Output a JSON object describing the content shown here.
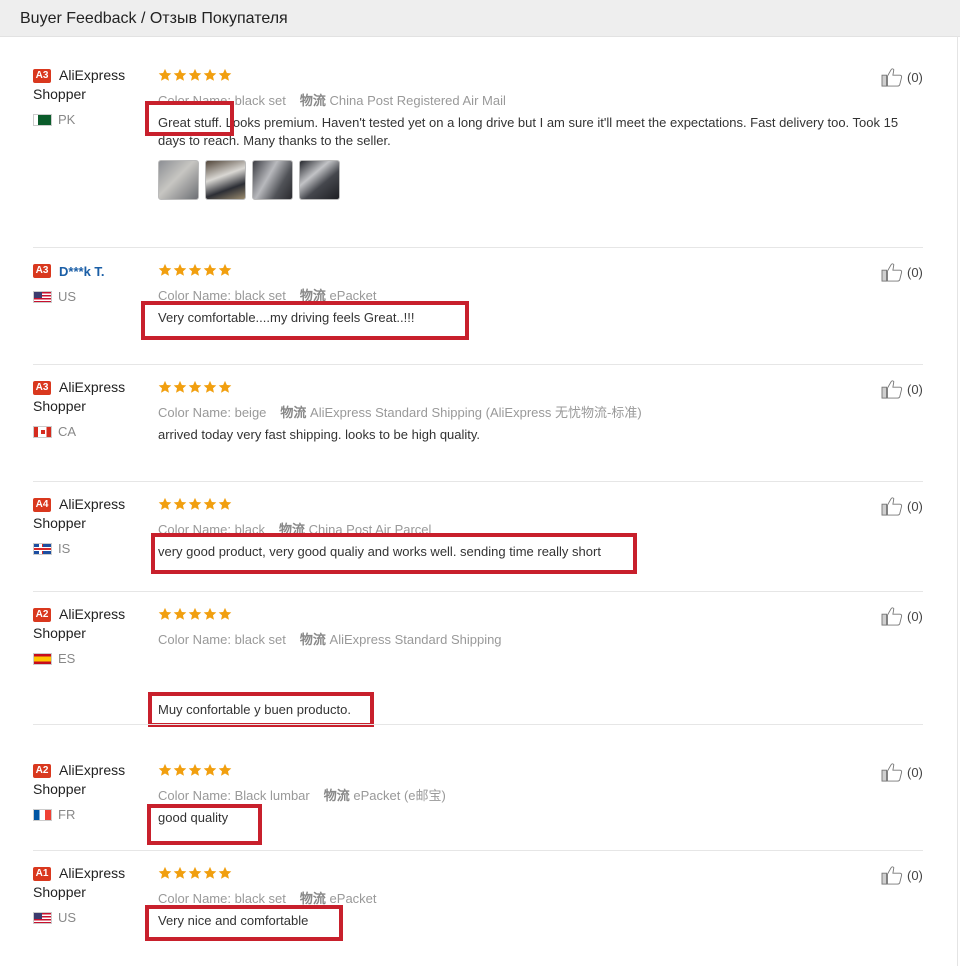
{
  "header": {
    "title": "Buyer Feedback / Отзыв Покупателя"
  },
  "colors": {
    "highlight": "#c8202c",
    "badge": "#d9381e",
    "star": "#f19f0f"
  },
  "reviews": [
    {
      "badge": "A3",
      "name": "AliExpress Shopper",
      "country": "PK",
      "flag": "pk",
      "stars": 5,
      "color_label": "Color Name:",
      "color_value": "black set",
      "shipping_label": "物流",
      "shipping_value": "China Post Registered Air Mail",
      "text": "Great stuff. Looks premium. Haven't tested yet on a long drive but I am sure it'll meet the expectations. Fast delivery too. Took 15 days to reach. Many thanks to the seller.",
      "photos": 4,
      "likes": "(0)"
    },
    {
      "badge": "A3",
      "name": "D***k T.",
      "country": "US",
      "flag": "us",
      "stars": 5,
      "color_label": "Color Name:",
      "color_value": "black set",
      "shipping_label": "物流",
      "shipping_value": "ePacket",
      "text": "Very comfortable....my driving feels Great..!!!",
      "likes": "(0)"
    },
    {
      "badge": "A3",
      "name": "AliExpress Shopper",
      "country": "CA",
      "flag": "ca",
      "stars": 5,
      "color_label": "Color Name:",
      "color_value": "beige",
      "shipping_label": "物流",
      "shipping_value": "AliExpress Standard Shipping (AliExpress 无忧物流-标准)",
      "text": "arrived today very fast shipping. looks to be high quality.",
      "likes": "(0)"
    },
    {
      "badge": "A4",
      "name": "AliExpress Shopper",
      "country": "IS",
      "flag": "is",
      "stars": 5,
      "color_label": "Color Name:",
      "color_value": "black",
      "shipping_label": "物流",
      "shipping_value": "China Post Air Parcel",
      "text": "very good product, very good qualiy and works well. sending time really short",
      "likes": "(0)"
    },
    {
      "badge": "A2",
      "name": "AliExpress Shopper",
      "country": "ES",
      "flag": "es",
      "stars": 5,
      "color_label": "Color Name:",
      "color_value": "black set",
      "shipping_label": "物流",
      "shipping_value": "AliExpress Standard Shipping",
      "text": "Muy confortable y buen producto.",
      "likes": "(0)"
    },
    {
      "badge": "A2",
      "name": "AliExpress Shopper",
      "country": "FR",
      "flag": "fr",
      "stars": 5,
      "color_label": "Color Name:",
      "color_value": "Black lumbar",
      "shipping_label": "物流",
      "shipping_value": "ePacket (e邮宝)",
      "text": "good quality",
      "likes": "(0)"
    },
    {
      "badge": "A1",
      "name": "AliExpress Shopper",
      "country": "US",
      "flag": "us",
      "stars": 5,
      "color_label": "Color Name:",
      "color_value": "black set",
      "shipping_label": "物流",
      "shipping_value": "ePacket",
      "text": "Very nice and comfortable",
      "likes": "(0)"
    }
  ]
}
